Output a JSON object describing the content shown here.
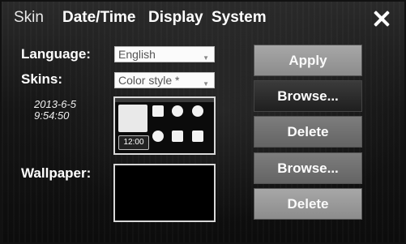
{
  "tabs": [
    {
      "label": "Skin",
      "active": true
    },
    {
      "label": "Date/Time",
      "active": false
    },
    {
      "label": "Display",
      "active": false
    },
    {
      "label": "System",
      "active": false
    }
  ],
  "close_icon": "close-x-icon",
  "settings": {
    "language_label": "Language:",
    "language_value": "English",
    "skins_label": "Skins:",
    "skins_value": "Color style *",
    "date": "2013-6-5",
    "time": "9:54:50",
    "wallpaper_label": "Wallpaper:"
  },
  "preview": {
    "clock": "12:00",
    "tile_colors": [
      "#ffffff",
      "#ffffff",
      "#ffffff",
      "#ffffff",
      "#ffffff",
      "#ffffff"
    ]
  },
  "buttons": {
    "apply": "Apply",
    "browse_skin": "Browse...",
    "delete_skin": "Delete",
    "browse_wallpaper": "Browse...",
    "delete_wallpaper": "Delete"
  },
  "colors": {
    "background": "#151515",
    "button_light": "#9a9a9a",
    "button_dark": "#2c2c2c"
  }
}
